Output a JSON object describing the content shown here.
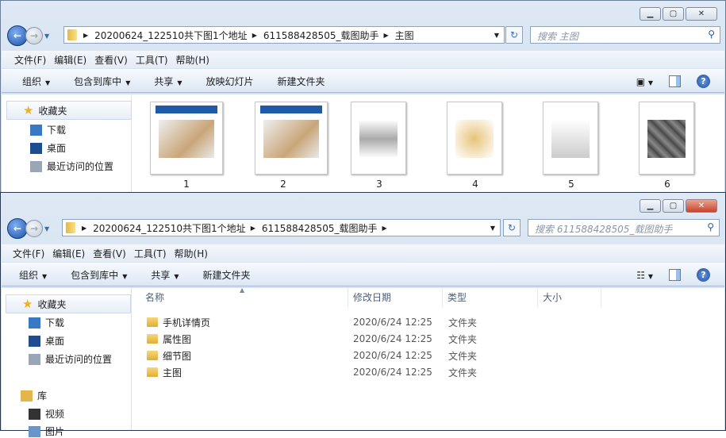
{
  "window1": {
    "breadcrumbs": [
      "20200624_122510共下图1个地址",
      "611588428505_载图助手",
      "主图"
    ],
    "search_placeholder": "搜索 主图",
    "menu": [
      "文件(F)",
      "编辑(E)",
      "查看(V)",
      "工具(T)",
      "帮助(H)"
    ],
    "toolbar": [
      "组织",
      "包含到库中",
      "共享",
      "放映幻灯片",
      "新建文件夹"
    ],
    "sidebar": {
      "favorites": "收藏夹",
      "items": [
        "下载",
        "桌面",
        "最近访问的位置"
      ]
    },
    "thumbnails": [
      "1",
      "2",
      "3",
      "4",
      "5",
      "6"
    ]
  },
  "window2": {
    "breadcrumbs": [
      "20200624_122510共下图1个地址",
      "611588428505_载图助手"
    ],
    "search_placeholder": "搜索 611588428505_载图助手",
    "menu": [
      "文件(F)",
      "编辑(E)",
      "查看(V)",
      "工具(T)",
      "帮助(H)"
    ],
    "toolbar": [
      "组织",
      "包含到库中",
      "共享",
      "新建文件夹"
    ],
    "sidebar": {
      "favorites": "收藏夹",
      "items": [
        "下载",
        "桌面",
        "最近访问的位置"
      ],
      "library": "库",
      "lib_items": [
        "视频",
        "图片"
      ]
    },
    "columns": [
      "名称",
      "修改日期",
      "类型",
      "大小"
    ],
    "files": [
      {
        "name": "手机详情页",
        "date": "2020/6/24 12:25",
        "type": "文件夹"
      },
      {
        "name": "属性图",
        "date": "2020/6/24 12:25",
        "type": "文件夹"
      },
      {
        "name": "细节图",
        "date": "2020/6/24 12:25",
        "type": "文件夹"
      },
      {
        "name": "主图",
        "date": "2020/6/24 12:25",
        "type": "文件夹"
      }
    ]
  }
}
